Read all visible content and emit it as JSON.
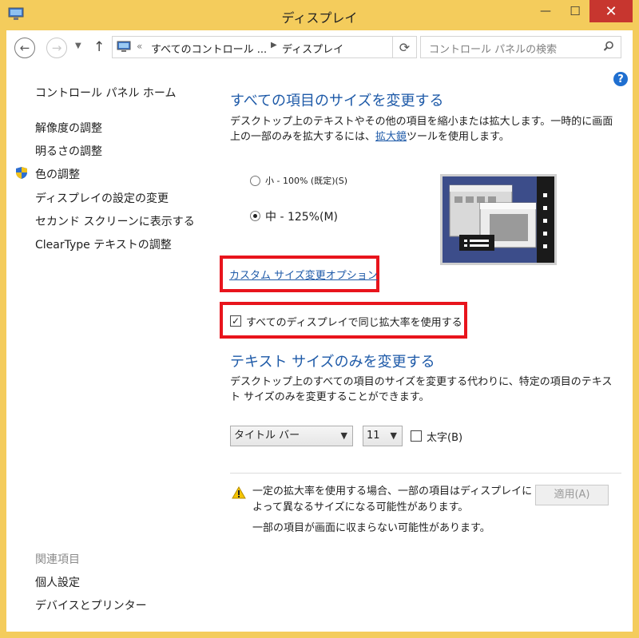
{
  "window": {
    "title": "ディスプレイ",
    "close_glyph": "✕",
    "minimize_glyph": "—",
    "maximize_glyph": "☐"
  },
  "address": {
    "back_glyph": "←",
    "forward_glyph": "→",
    "up_glyph": "↑",
    "overflow": "«",
    "crumb1": "すべてのコントロール ...",
    "crumb2": "ディスプレイ",
    "refresh_glyph": "⟳",
    "search_placeholder": "コントロール パネルの検索"
  },
  "help_glyph": "?",
  "sidebar": {
    "home": "コントロール パネル ホーム",
    "items": [
      "解像度の調整",
      "明るさの調整",
      "色の調整",
      "ディスプレイの設定の変更",
      "セカンド スクリーンに表示する",
      "ClearType テキストの調整"
    ],
    "related_heading": "関連項目",
    "related": [
      "個人設定",
      "デバイスとプリンター"
    ]
  },
  "main": {
    "heading1": "すべての項目のサイズを変更する",
    "desc1_a": "デスクトップ上のテキストやその他の項目を縮小または拡大します。一時的に画面上の一部のみを拡大するには、",
    "desc1_link": "拡大鏡",
    "desc1_b": "ツールを使用します。",
    "radio_small": "小 - 100% (既定)(S)",
    "radio_medium": "中 - 125%(M)",
    "selected_size": "medium",
    "custom_link": "カスタム サイズ変更オプション",
    "same_scale_label": "すべてのディスプレイで同じ拡大率を使用する",
    "same_scale_checked": true,
    "heading2": "テキスト サイズのみを変更する",
    "desc2": "デスクトップ上のすべての項目のサイズを変更する代わりに、特定の項目のテキスト サイズのみを変更することができます。",
    "item_select": "タイトル バー",
    "size_select": "11",
    "bold_label": "太字(B)",
    "bold_checked": false,
    "warning1": "一定の拡大率を使用する場合、一部の項目はディスプレイによって異なるサイズになる可能性があります。",
    "warning2": "一部の項目が画面に収まらない可能性があります。",
    "apply_label": "適用(A)"
  },
  "colors": {
    "frame": "#f4cc5c",
    "link": "#1e5aa8",
    "highlight": "#e8141c",
    "close": "#c7362f"
  }
}
